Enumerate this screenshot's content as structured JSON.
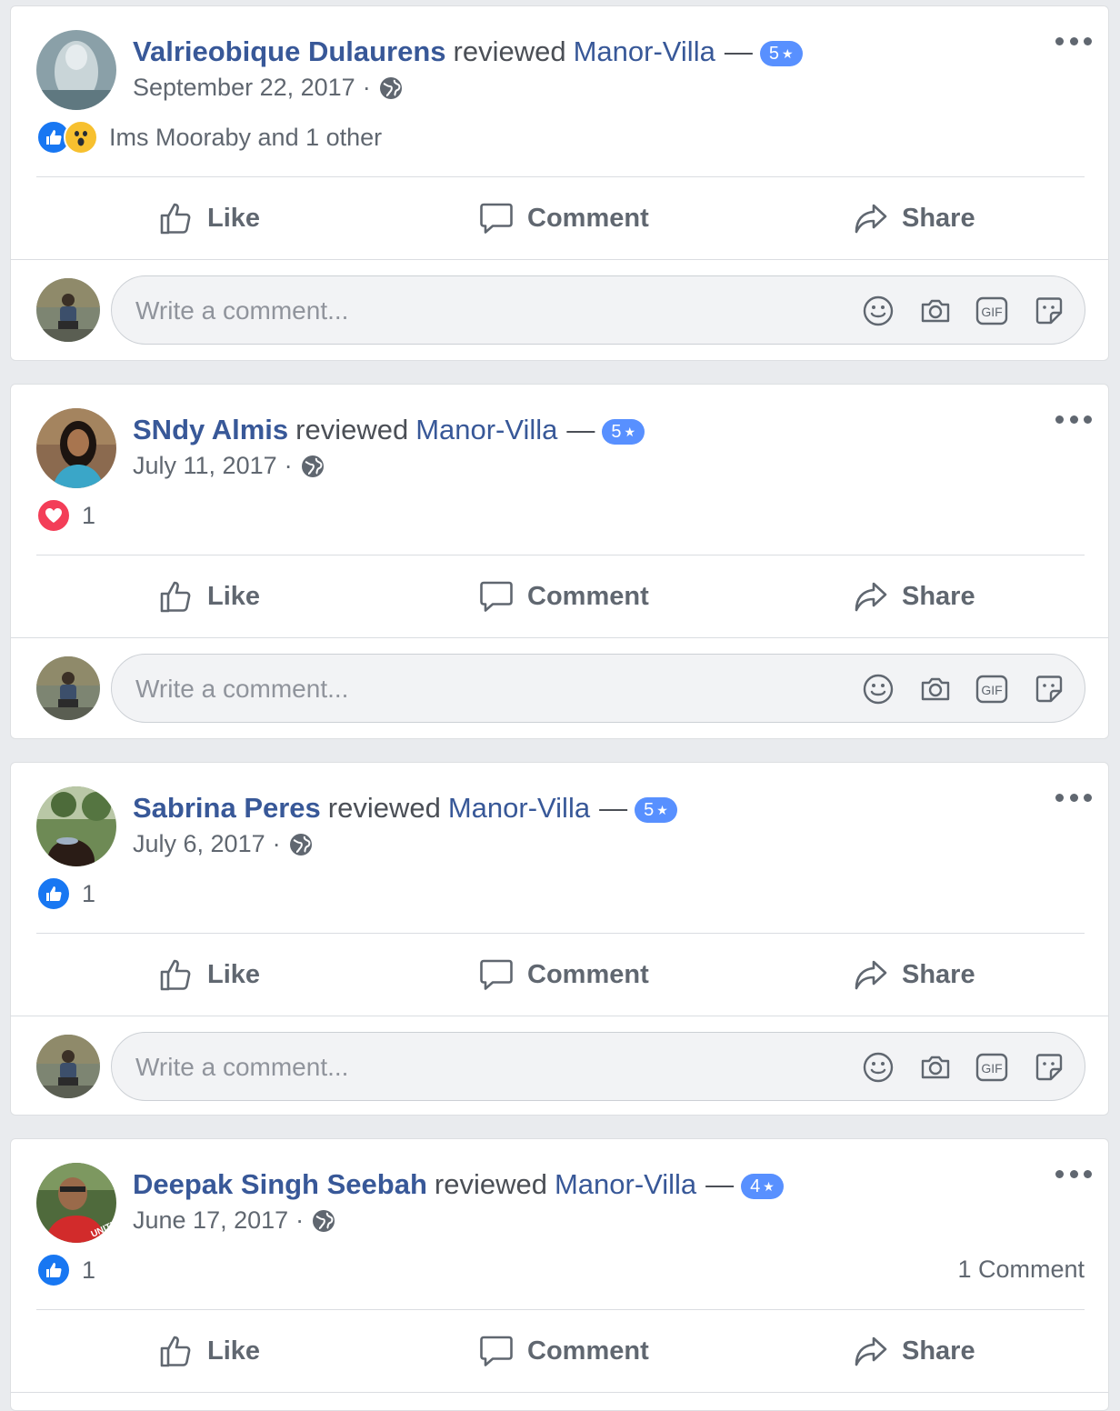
{
  "colors": {
    "link": "#385898",
    "secondary_text": "#606770",
    "rating_badge": "#5890ff",
    "like_blue": "#1877f2",
    "love_red": "#f33e58",
    "wow_yellow": "#f7c02f",
    "background": "#e9ebee"
  },
  "composer": {
    "placeholder": "Write a comment..."
  },
  "actions": {
    "like": "Like",
    "comment": "Comment",
    "share": "Share"
  },
  "reviews": [
    {
      "author": "Valrieobique Dulaurens",
      "verb": "reviewed",
      "page": "Manor-Villa",
      "dash": "—",
      "rating": "5",
      "rating_icon": "star-icon",
      "date": "September 22, 2017",
      "dot": "·",
      "privacy_icon": "globe-icon",
      "reactions": [
        "like-icon",
        "wow-icon"
      ],
      "reaction_text": "Ims Mooraby and 1 other",
      "comments_text": ""
    },
    {
      "author": "SNdy Almis",
      "verb": "reviewed",
      "page": "Manor-Villa",
      "dash": "—",
      "rating": "5",
      "rating_icon": "star-icon",
      "date": "July 11, 2017",
      "dot": "·",
      "privacy_icon": "globe-icon",
      "reactions": [
        "love-icon"
      ],
      "reaction_text": "1",
      "comments_text": ""
    },
    {
      "author": "Sabrina Peres",
      "verb": "reviewed",
      "page": "Manor-Villa",
      "dash": "—",
      "rating": "5",
      "rating_icon": "star-icon",
      "date": "July 6, 2017",
      "dot": "·",
      "privacy_icon": "globe-icon",
      "reactions": [
        "like-icon"
      ],
      "reaction_text": "1",
      "comments_text": ""
    },
    {
      "author": "Deepak Singh Seebah",
      "verb": "reviewed",
      "page": "Manor-Villa",
      "dash": "—",
      "rating": "4",
      "rating_icon": "star-icon",
      "date": "June 17, 2017",
      "dot": "·",
      "privacy_icon": "globe-icon",
      "reactions": [
        "like-icon"
      ],
      "reaction_text": "1",
      "comments_text": "1 Comment"
    }
  ]
}
